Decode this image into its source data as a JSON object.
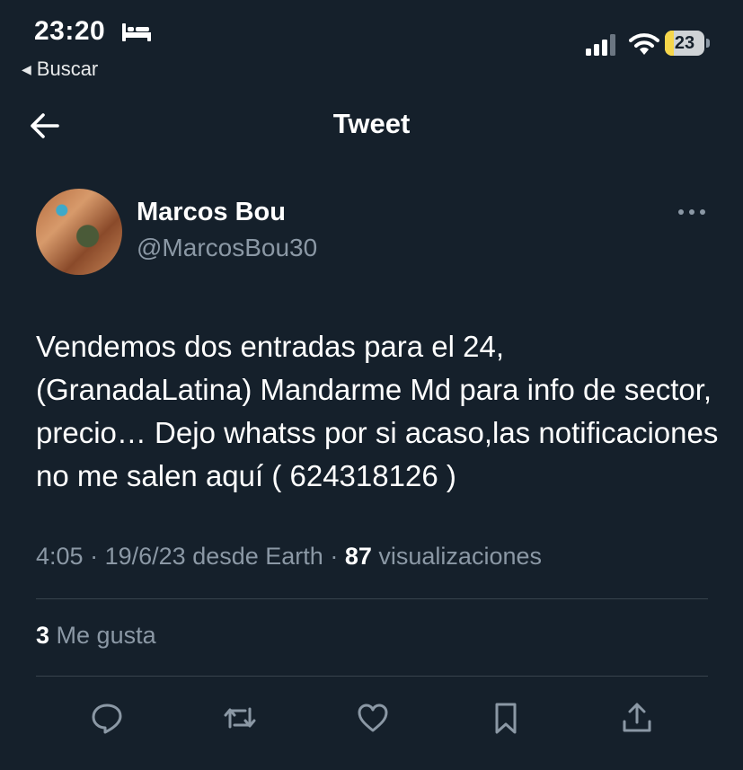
{
  "status_bar": {
    "time": "23:20",
    "back_app_label": "Buscar",
    "battery_level": "23",
    "battery_fraction": 0.23,
    "icons": [
      "bed-icon",
      "signal-icon",
      "wifi-icon",
      "battery-icon"
    ]
  },
  "nav": {
    "title": "Tweet",
    "back_icon": "arrow-left-icon"
  },
  "tweet": {
    "author_name": "Marcos Bou",
    "author_handle": "@MarcosBou30",
    "text": "Vendemos dos entradas para el 24, (GranadaLatina) Mandarme Md para info de sector, precio… Dejo whatss por si acaso,las notificaciones no me salen aquí ( 624318126 )",
    "time": "4:05",
    "date": "19/6/23",
    "source": "desde Earth",
    "views_count": "87",
    "views_label": "visualizaciones",
    "separator": "·",
    "likes_count": "3",
    "likes_label": "Me gusta"
  },
  "actions": [
    "reply-icon",
    "retweet-icon",
    "like-icon",
    "bookmark-icon",
    "share-icon"
  ],
  "colors": {
    "background": "#15202b",
    "text": "#ffffff",
    "secondary_text": "#8b98a5",
    "divider": "#38444d",
    "battery": "#f6d64a"
  }
}
